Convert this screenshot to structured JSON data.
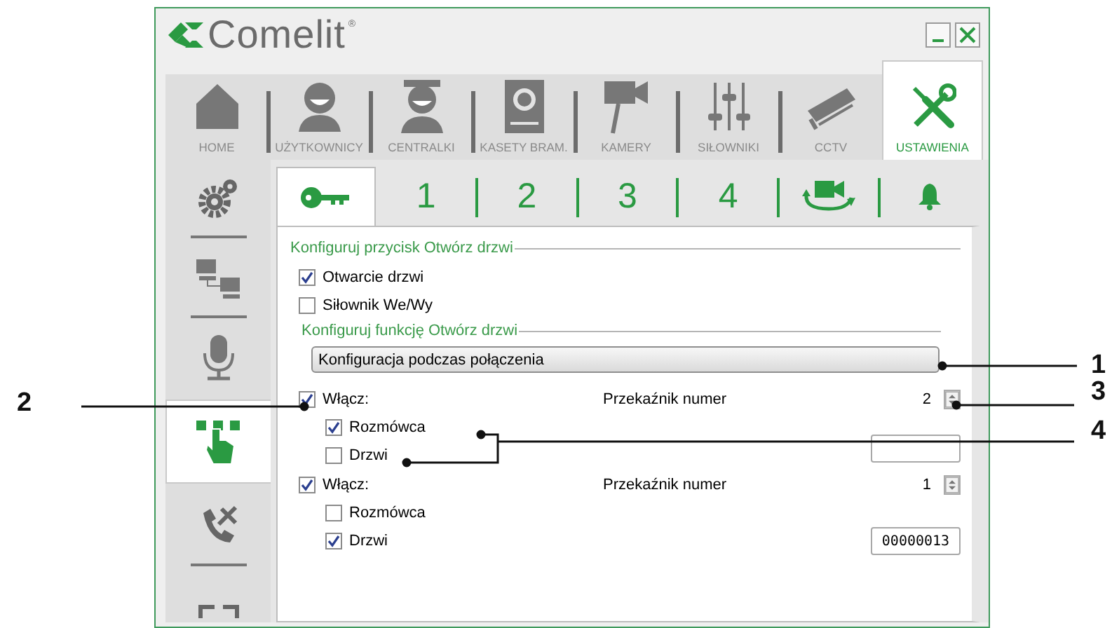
{
  "window": {
    "logo": {
      "name": "Comelit",
      "mark": "®"
    }
  },
  "nav_tabs": [
    {
      "label": "HOME",
      "selected": false
    },
    {
      "label": "UŻYTKOWNICY",
      "selected": false
    },
    {
      "label": "CENTRALKI",
      "selected": false
    },
    {
      "label": "KASETY BRAM.",
      "selected": false
    },
    {
      "label": "KAMERY",
      "selected": false
    },
    {
      "label": "SIŁOWNIKI",
      "selected": false
    },
    {
      "label": "CCTV",
      "selected": false
    },
    {
      "label": "USTAWIENIA",
      "selected": true
    }
  ],
  "sidebar": {
    "items": [
      {
        "selected": false
      },
      {
        "selected": false
      },
      {
        "selected": false
      },
      {
        "selected": true
      },
      {
        "selected": false
      },
      {
        "selected": false
      }
    ]
  },
  "sub_tabs": [
    {
      "selected": true
    },
    {
      "label": "1",
      "selected": false
    },
    {
      "label": "2",
      "selected": false
    },
    {
      "label": "3",
      "selected": false
    },
    {
      "label": "4",
      "selected": false
    },
    {
      "selected": false
    },
    {
      "selected": false
    }
  ],
  "section1": {
    "title": "Konfiguruj przycisk Otwórz drzwi",
    "options": [
      {
        "label": "Otwarcie drzwi",
        "checked": true
      },
      {
        "label": "Siłownik We/Wy",
        "checked": false
      }
    ]
  },
  "section2": {
    "title": "Konfiguruj funkcję Otwórz drzwi",
    "dropdown": {
      "value": "Konfiguracja podczas połączenia"
    },
    "relays": [
      {
        "label": "Włącz:",
        "checked": true,
        "relay_label": "Przekaźnik numer",
        "relay_number": "2",
        "targets": [
          {
            "label": "Rozmówca",
            "checked": true
          },
          {
            "label": "Drzwi",
            "checked": false
          }
        ]
      },
      {
        "label": "Włącz:",
        "checked": true,
        "relay_label": "Przekaźnik numer",
        "relay_number": "1",
        "targets": [
          {
            "label": "Rozmówca",
            "checked": false
          },
          {
            "label": "Drzwi",
            "checked": true
          }
        ],
        "code": "00000013"
      }
    ]
  },
  "callouts": [
    {
      "label": "1"
    },
    {
      "label": "2"
    },
    {
      "label": "3"
    },
    {
      "label": "4"
    }
  ]
}
